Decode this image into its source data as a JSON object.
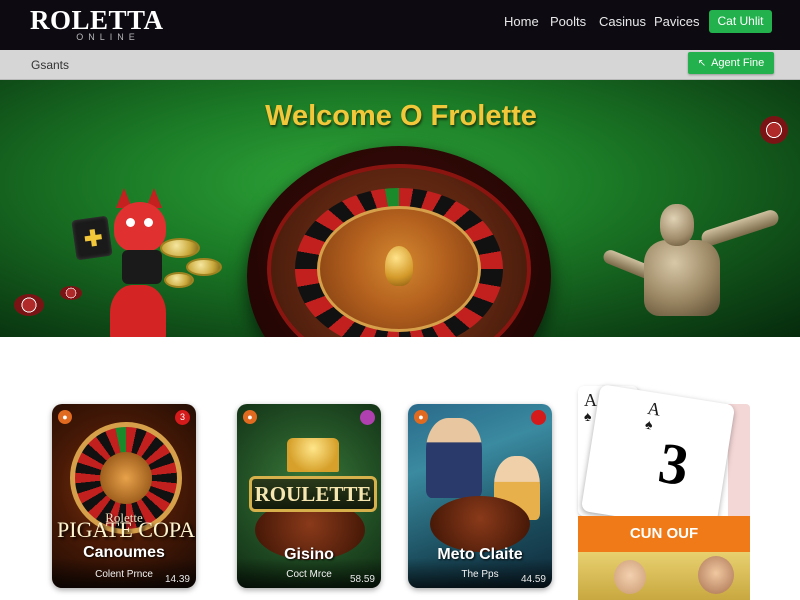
{
  "header": {
    "logo_main": "ROLETTA",
    "logo_sub": "ONLINE",
    "nav": [
      "Home",
      "Poolts",
      "Casinus",
      "Pavices"
    ],
    "cta_label": "Cat Uhlit"
  },
  "subbar": {
    "label": "Gsants",
    "button_label": "Agent Fine",
    "button_icon": "arrow-icon"
  },
  "hero": {
    "title": "Welcome O Frolette"
  },
  "cards": [
    {
      "badge_left": "",
      "badge_right": "3",
      "big_top": "Rolette",
      "big_title": "PIGATE COPA",
      "title": "Canoumes",
      "subtitle": "Colent Prnce",
      "number": "14.39"
    },
    {
      "badge_left": "",
      "badge_right": "",
      "sign_text": "ROULETTE",
      "title": "Gisino",
      "subtitle": "Coct Mrce",
      "number": "58.59"
    },
    {
      "badge_left": "",
      "badge_right": "",
      "title": "Meto Claite",
      "subtitle": "The Pps",
      "number": "44.59"
    }
  ],
  "playing_cards": {
    "back_rank": "A",
    "back_suit": "♠",
    "front_rank": "A",
    "front_suit": "♠",
    "front_big": "3",
    "button_label": "CUN OUF"
  },
  "colors": {
    "header_bg": "#0d0a12",
    "accent_green": "#22b14c",
    "hero_title": "#f2c83a",
    "orange_button": "#f07a18",
    "badge_red": "#d41a1a"
  }
}
